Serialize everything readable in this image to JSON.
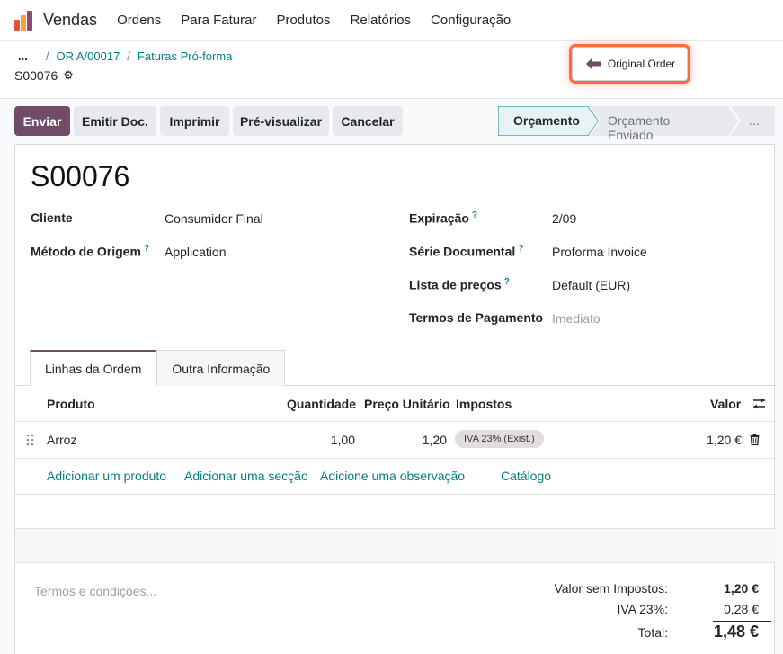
{
  "topnav": {
    "app_name": "Vendas",
    "menu": [
      "Ordens",
      "Para Faturar",
      "Produtos",
      "Relatórios",
      "Configuração"
    ]
  },
  "breadcrumb": {
    "dots": "...",
    "items": [
      "OR A/00017",
      "Faturas Pró-forma"
    ]
  },
  "record": {
    "name": "S00076"
  },
  "original_order_label": "Original Order",
  "actions": {
    "enviar": "Enviar",
    "emitir": "Emitir Doc.",
    "imprimir": "Imprimir",
    "previsualizar": "Pré-visualizar",
    "cancelar": "Cancelar"
  },
  "status": {
    "stages": [
      "Orçamento",
      "Orçamento Enviado",
      "..."
    ],
    "active": "Orçamento"
  },
  "form": {
    "title": "S00076",
    "fields_left": [
      {
        "label": "Cliente",
        "value": "Consumidor Final",
        "help": ""
      },
      {
        "label": "Método de Origem",
        "value": "Application",
        "help": "?"
      }
    ],
    "fields_right": [
      {
        "label": "Expiração",
        "value": "2/09",
        "help": "?"
      },
      {
        "label": "Série Documental",
        "value": "Proforma Invoice",
        "help": "?"
      },
      {
        "label": "Lista de preços",
        "value": "Default (EUR)",
        "help": "?"
      },
      {
        "label": "Termos de Pagamento",
        "value": "Imediato",
        "help": ""
      }
    ]
  },
  "tabs": [
    "Linhas da Ordem",
    "Outra Informação"
  ],
  "table": {
    "headers": {
      "produto": "Produto",
      "quantidade": "Quantidade",
      "preco": "Preço Unitário",
      "impostos": "Impostos",
      "valor": "Valor"
    },
    "rows": [
      {
        "produto": "Arroz",
        "quantidade": "1,00",
        "preco": "1,20",
        "imposto": "IVA 23% (Exist.)",
        "valor": "1,20 €"
      }
    ],
    "links": [
      "Adicionar um produto",
      "Adicionar uma secção",
      "Adicione uma observação",
      "Catálogo"
    ]
  },
  "footer": {
    "terms_placeholder": "Termos e condições...",
    "totals": [
      {
        "label": "Valor sem Impostos:",
        "value": "1,20 €"
      },
      {
        "label": "IVA 23%:",
        "value": "0,28 €"
      },
      {
        "label": "Total:",
        "value": "1,48 €"
      }
    ]
  },
  "colors": {
    "primary": "#714b67",
    "link": "#017e84",
    "highlight": "#ff6a3d"
  }
}
